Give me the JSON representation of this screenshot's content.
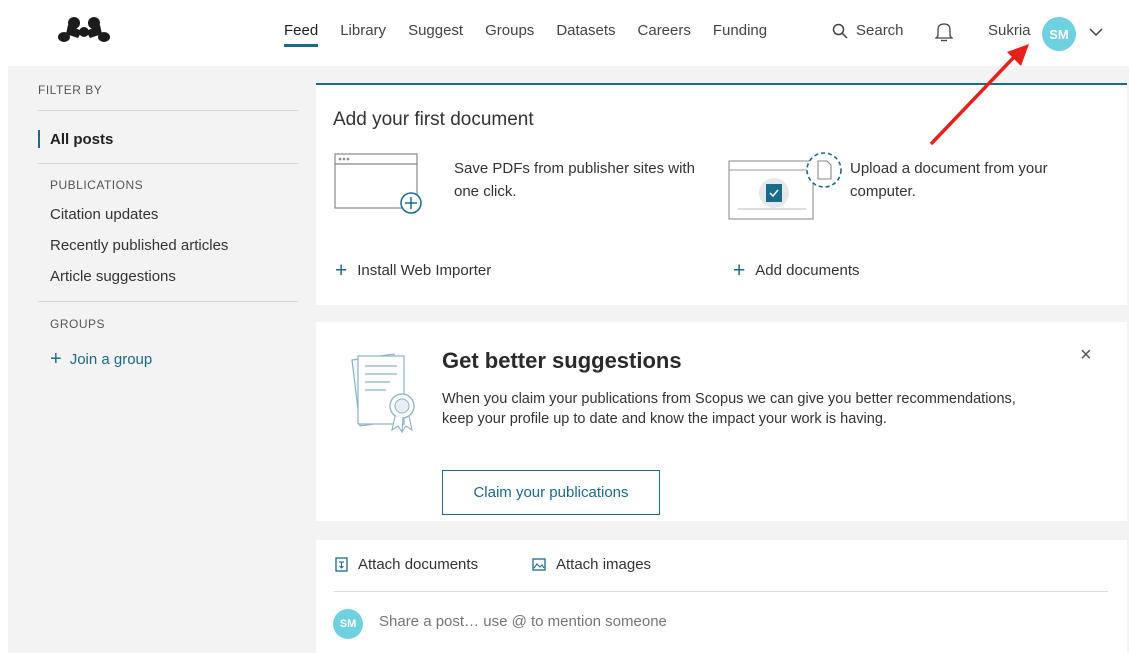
{
  "nav": {
    "items": [
      "Feed",
      "Library",
      "Suggest",
      "Groups",
      "Datasets",
      "Careers",
      "Funding"
    ],
    "active": "Feed",
    "search_label": "Search",
    "user_name": "Sukria",
    "avatar_initials": "SM",
    "icons": [
      "mendeley-logo-icon",
      "search-icon",
      "bell-icon",
      "chevron-down-icon"
    ]
  },
  "sidebar": {
    "filter_heading": "FILTER BY",
    "all_posts": "All posts",
    "publications_heading": "PUBLICATIONS",
    "publications": [
      "Citation updates",
      "Recently published articles",
      "Article suggestions"
    ],
    "groups_heading": "GROUPS",
    "join_group": "Join a group"
  },
  "add_document": {
    "title": "Add your first document",
    "web_importer_text": "Save PDFs from publisher sites with one click.",
    "upload_text": "Upload a document from your computer.",
    "install_label": "Install Web Importer",
    "add_label": "Add documents"
  },
  "suggestions": {
    "title": "Get better suggestions",
    "body": "When you claim your publications from Scopus we can give you better recommendations, keep your profile up to date and know the impact your work is having.",
    "button": "Claim your publications",
    "close": "×"
  },
  "composer": {
    "attach_documents": "Attach documents",
    "attach_images": "Attach images",
    "avatar_initials": "SM",
    "placeholder": "Share a post… use @ to mention someone"
  },
  "colors": {
    "accent": "#1a6b8a",
    "avatar": "#6fd0e0",
    "annotation_arrow": "#e8201a"
  }
}
